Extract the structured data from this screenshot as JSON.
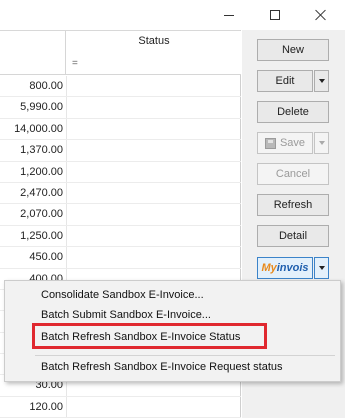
{
  "grid": {
    "status_header": "Status",
    "filter_glyph": "=",
    "amounts": [
      "800.00",
      "5,990.00",
      "14,000.00",
      "1,370.00",
      "1,200.00",
      "2,470.00",
      "2,070.00",
      "1,250.00",
      "450.00",
      "400.00",
      "",
      "",
      "",
      "",
      "30.00",
      "120.00"
    ]
  },
  "buttons": {
    "new": "New",
    "edit": "Edit",
    "delete": "Delete",
    "save": "Save",
    "cancel": "Cancel",
    "refresh": "Refresh",
    "detail": "Detail",
    "myinvois_prefix": "My",
    "myinvois_suffix": "invois"
  },
  "menu": {
    "items": [
      "Consolidate Sandbox E-Invoice...",
      "Batch Submit Sandbox E-Invoice...",
      "Batch Refresh Sandbox E-Invoice Status",
      "Batch Refresh Sandbox E-Invoice Request status"
    ]
  },
  "colors": {
    "highlight": "#e0282f",
    "myinvois_orange": "#e8891a",
    "myinvois_blue": "#1f5fae"
  }
}
